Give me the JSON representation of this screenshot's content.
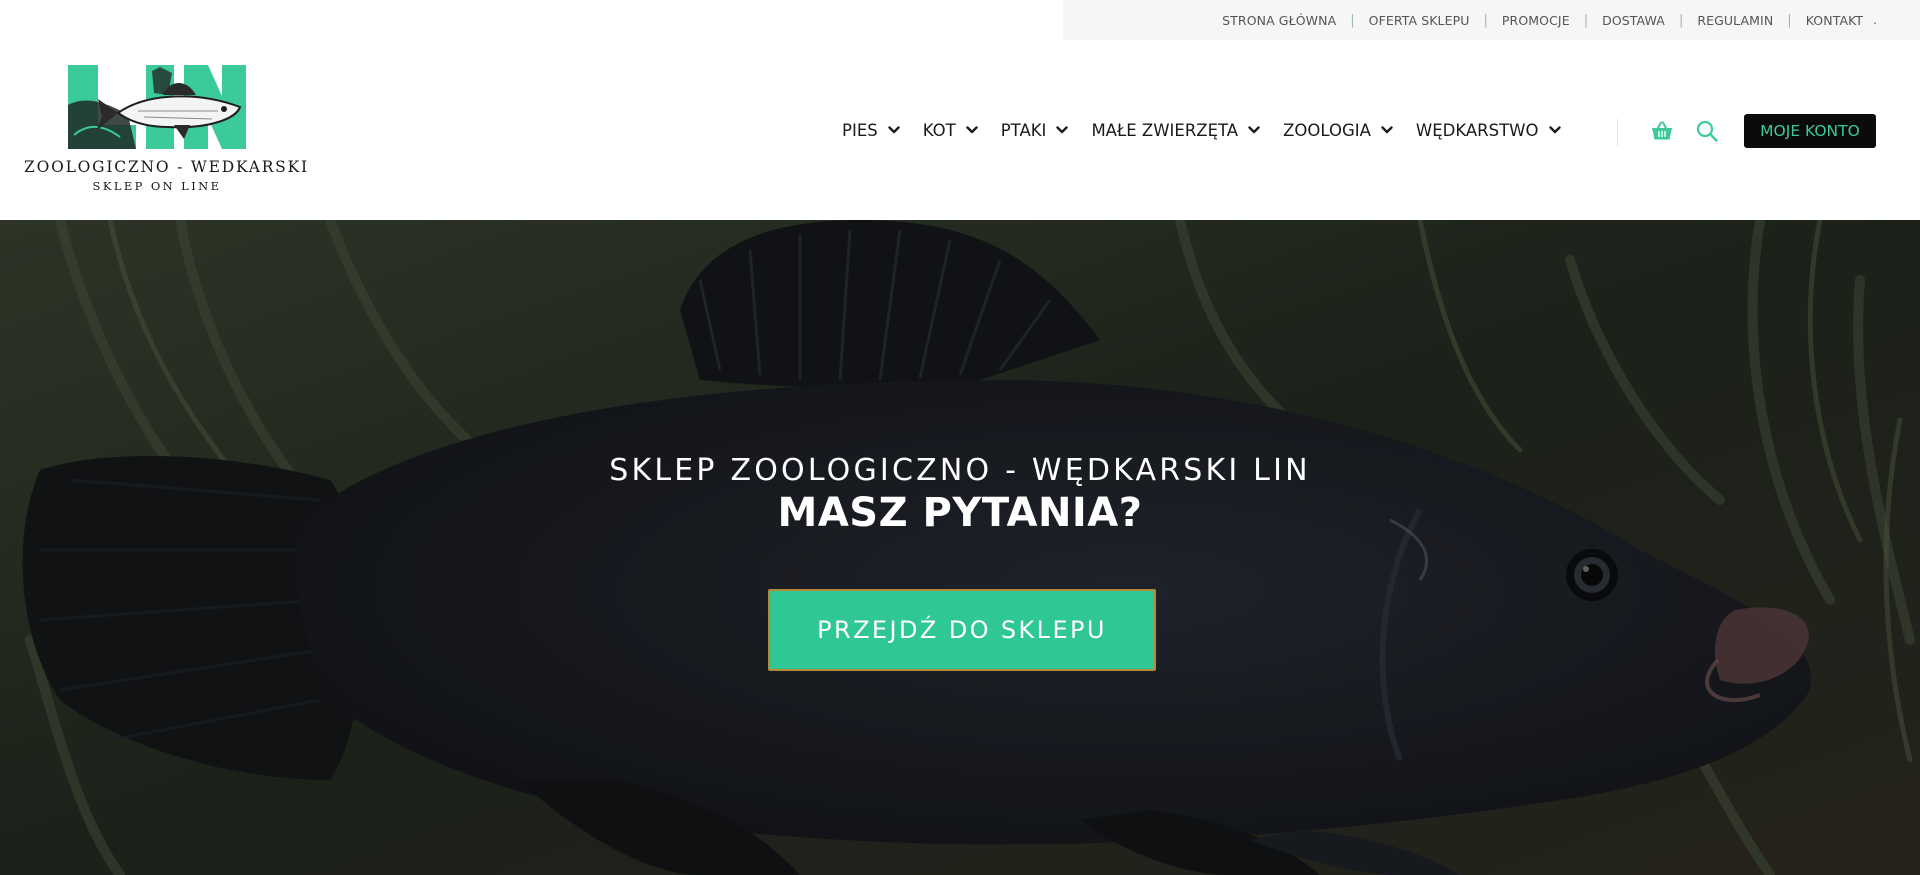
{
  "top_links": [
    "STRONA GŁÓWNA",
    "OFERTA SKLEPU",
    "PROMOCJE",
    "DOSTAWA",
    "REGULAMIN",
    "KONTAKT"
  ],
  "top_trailing": ".",
  "logo": {
    "mark_text": "LIN",
    "title": "ZOOLOGICZNO - WEDKARSKI",
    "subtitle": "SKLEP ON LINE"
  },
  "nav": [
    {
      "label": "PIES"
    },
    {
      "label": "KOT"
    },
    {
      "label": "PTAKI"
    },
    {
      "label": "MAŁE ZWIERZĘTA"
    },
    {
      "label": "ZOOLOGIA"
    },
    {
      "label": "WĘDKARSTWO"
    }
  ],
  "icons": {
    "cart": "basket-icon",
    "search": "search-icon",
    "chevron": "chevron-down-icon"
  },
  "account_label": "MOJE KONTO",
  "hero": {
    "tagline": "SKLEP ZOOLOGICZNO - WĘDKARSKI LIN",
    "title": "MASZ PYTANIA?",
    "button_label": "PRZEJDŹ DO SKLEPU"
  },
  "colors": {
    "accent": "#2fc894",
    "account_text": "#3ccb98",
    "button_border": "#b48a3a",
    "dark": "#0b0b0b"
  }
}
